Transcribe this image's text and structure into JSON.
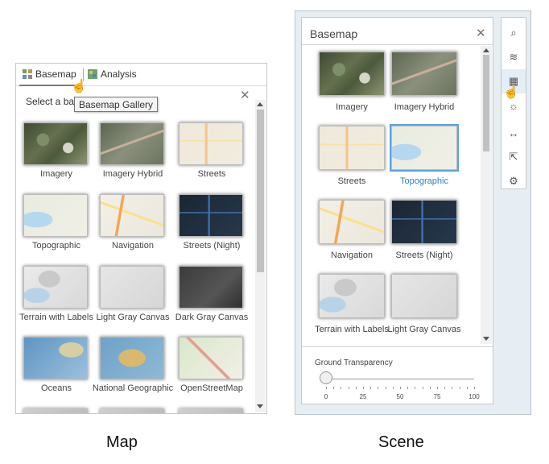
{
  "captions": {
    "map": "Map",
    "scene": "Scene"
  },
  "map_panel": {
    "tabs": [
      {
        "label": "Basemap",
        "icon": "basemap-icon"
      },
      {
        "label": "Analysis",
        "icon": "analysis-icon"
      }
    ],
    "tooltip": "Basemap Gallery",
    "subtitle": "Select a bas",
    "close_glyph": "✕",
    "tiles": [
      {
        "label": "Imagery",
        "thumb": "t-imagery"
      },
      {
        "label": "Imagery Hybrid",
        "thumb": "t-imagery-hybrid"
      },
      {
        "label": "Streets",
        "thumb": "t-streets"
      },
      {
        "label": "Topographic",
        "thumb": "t-topo"
      },
      {
        "label": "Navigation",
        "thumb": "t-navigation"
      },
      {
        "label": "Streets (Night)",
        "thumb": "t-streets-night"
      },
      {
        "label": "Terrain with Labels",
        "thumb": "t-terrain"
      },
      {
        "label": "Light Gray Canvas",
        "thumb": "t-light-gray"
      },
      {
        "label": "Dark Gray Canvas",
        "thumb": "t-dark-gray"
      },
      {
        "label": "Oceans",
        "thumb": "t-oceans"
      },
      {
        "label": "National Geographic",
        "thumb": "t-natgeo"
      },
      {
        "label": "OpenStreetMap",
        "thumb": "t-osm"
      }
    ]
  },
  "scene_panel": {
    "title": "Basemap",
    "close_glyph": "✕",
    "tiles": [
      {
        "label": "Imagery",
        "thumb": "t-imagery",
        "selected": false
      },
      {
        "label": "Imagery Hybrid",
        "thumb": "t-imagery-hybrid",
        "selected": false
      },
      {
        "label": "Streets",
        "thumb": "t-streets",
        "selected": false
      },
      {
        "label": "Topographic",
        "thumb": "t-topo",
        "selected": true
      },
      {
        "label": "Navigation",
        "thumb": "t-navigation",
        "selected": false
      },
      {
        "label": "Streets (Night)",
        "thumb": "t-streets-night",
        "selected": false
      },
      {
        "label": "Terrain with Labels",
        "thumb": "t-terrain",
        "selected": false
      },
      {
        "label": "Light Gray Canvas",
        "thumb": "t-light-gray",
        "selected": false
      }
    ],
    "ground_transparency": {
      "label": "Ground Transparency",
      "value": 0,
      "ticks": [
        "0",
        "25",
        "50",
        "75",
        "100"
      ]
    },
    "toolbar": [
      {
        "icon": "search-icon",
        "glyph": "⌕",
        "active": false
      },
      {
        "icon": "layers-icon",
        "glyph": "≋",
        "active": false
      },
      {
        "icon": "basemap-gallery-icon",
        "glyph": "▦",
        "active": true
      },
      {
        "icon": "daylight-icon",
        "glyph": "☼",
        "active": false
      },
      {
        "icon": "measure-icon",
        "glyph": "↔",
        "active": false
      },
      {
        "icon": "share-icon",
        "glyph": "⇱",
        "active": false
      },
      {
        "icon": "settings-icon",
        "glyph": "⚙",
        "active": false
      }
    ]
  },
  "colors": {
    "selected": "#5fa2de",
    "selected_label": "#2f7fc7"
  }
}
